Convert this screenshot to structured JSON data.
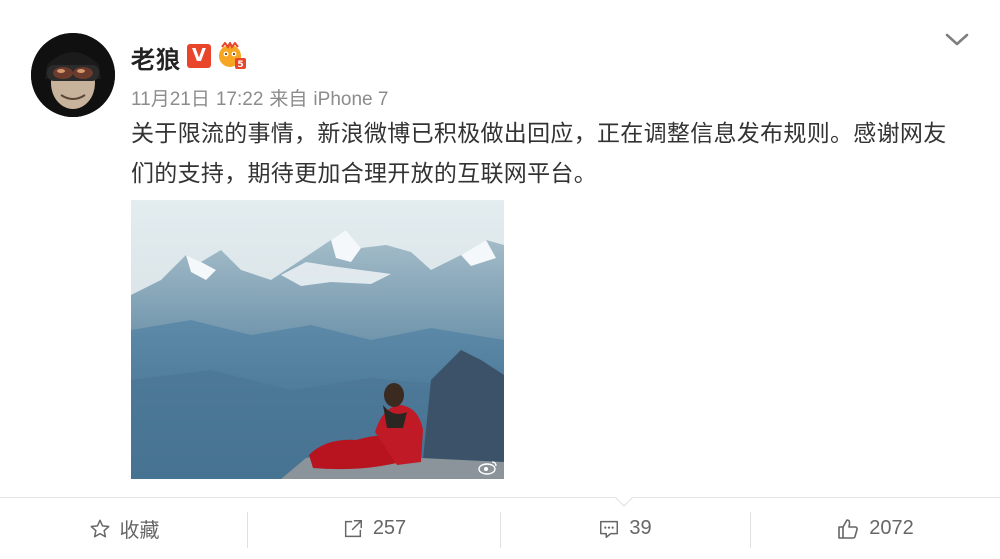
{
  "post": {
    "author": "老狼",
    "verified_badge": "V",
    "date": "11月21日",
    "time": "17:22",
    "source_prefix": "来自",
    "source_device": "iPhone 7",
    "text": "关于限流的事情，新浪微博已积极做出回应，正在调整信息发布规则。感谢网友们的支持，期待更加合理开放的互联网平台。",
    "image_description_icon": "photo-mountain-sleeping-bag"
  },
  "actions": {
    "favorite_label": "收藏",
    "repost_count": "257",
    "comment_count": "39",
    "like_count": "2072"
  },
  "colors": {
    "verified": "#e8452b",
    "meta_text": "#8c8c8c",
    "body_text": "#333333",
    "action_text": "#666666"
  }
}
